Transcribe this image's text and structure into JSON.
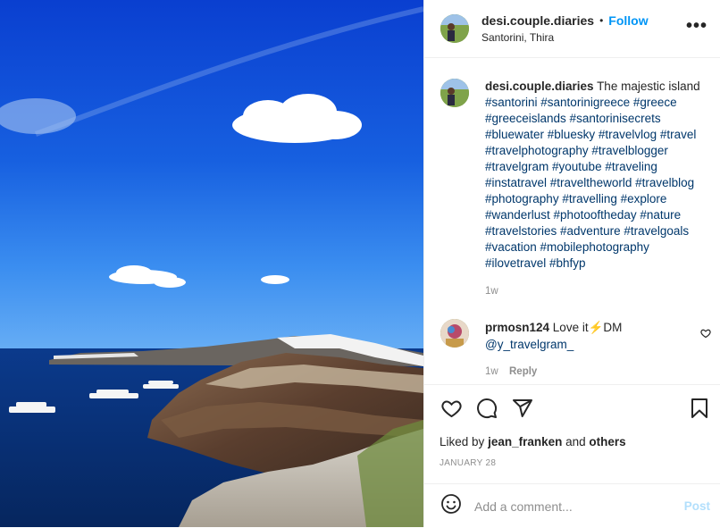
{
  "post": {
    "username": "desi.couple.diaries",
    "separator": "•",
    "follow_label": "Follow",
    "location": "Santorini, Thira",
    "more_label": "•••"
  },
  "caption": {
    "username": "desi.couple.diaries",
    "text": "The majestic island",
    "hashtags": "#santorini #santorinigreece #greece #greeceislands #santorinisecrets #bluewater #bluesky #travelvlog #travel #travelphotography #travelblogger #travelgram #youtube #traveling #instatravel #traveltheworld #travelblog #photography #travelling #explore #wanderlust #photooftheday #nature #travelstories #adventure #travelgoals #vacation #mobilephotography #ilovetravel #bhfyp",
    "time": "1w"
  },
  "comment": {
    "username": "prmosn124",
    "text_before": "Love it",
    "emoji": "⚡",
    "text_after": "DM",
    "mention": "@y_travelgram_",
    "time": "1w",
    "reply_label": "Reply"
  },
  "likes": {
    "prefix": "Liked by",
    "user": "jean_franken",
    "middle": "and",
    "others": "others"
  },
  "date": "JANUARY 28",
  "add_comment": {
    "placeholder": "Add a comment...",
    "post_label": "Post"
  },
  "colors": {
    "link_blue": "#0095f6",
    "hashtag": "#00376b",
    "post_disabled": "#b2dffc",
    "sky": "#1248c8"
  }
}
